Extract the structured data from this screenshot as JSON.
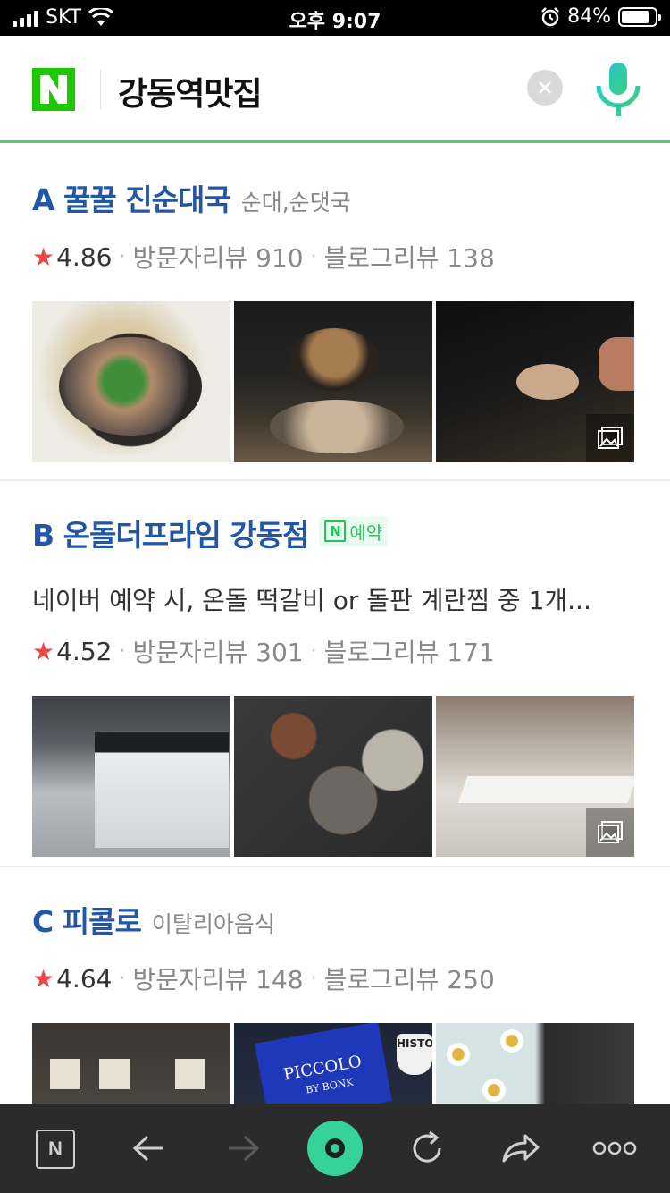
{
  "status_bar": {
    "carrier": "SKT",
    "time": "오후 9:07",
    "battery": "84%",
    "battery_level": 0.84
  },
  "search": {
    "query": "강동역맛집",
    "logo_letter": "N",
    "clear_icon": "close-icon",
    "mic_icon": "mic-icon"
  },
  "results": [
    {
      "letter": "A",
      "name": "꿀꿀 진순대국",
      "category": "순대,순댓국",
      "rating": "4.86",
      "visitor_reviews": "방문자리뷰 910",
      "blog_reviews": "블로그리뷰 138"
    },
    {
      "letter": "B",
      "name": "온돌더프라임 강동점",
      "badge": "예약",
      "badge_icon_letter": "N",
      "description": "네이버 예약 시, 온돌 떡갈비 or 돌판 계란찜 중 1개...",
      "rating": "4.52",
      "visitor_reviews": "방문자리뷰 301",
      "blog_reviews": "블로그리뷰 171"
    },
    {
      "letter": "C",
      "name": "피콜로",
      "category": "이탈리아음식",
      "rating": "4.64",
      "visitor_reviews": "방문자리뷰 148",
      "blog_reviews": "블로그리뷰 250"
    }
  ],
  "photo_text": {
    "c2_board": "PICCOLO",
    "c2_board_sub": "BY BONK",
    "c2_sign": "HISTO"
  },
  "toolbar": {
    "home_letter": "N",
    "items": [
      "naver-home-icon",
      "back-arrow-icon",
      "forward-arrow-icon",
      "green-dot-icon",
      "refresh-icon",
      "share-icon",
      "more-icon"
    ]
  },
  "colors": {
    "naver_green": "#1ec800",
    "title_blue": "#2356a7",
    "star_red": "#e94848",
    "header_line": "#4fcf75",
    "toolbar_bg": "#2b2b2b",
    "green_button": "#35d39a"
  }
}
